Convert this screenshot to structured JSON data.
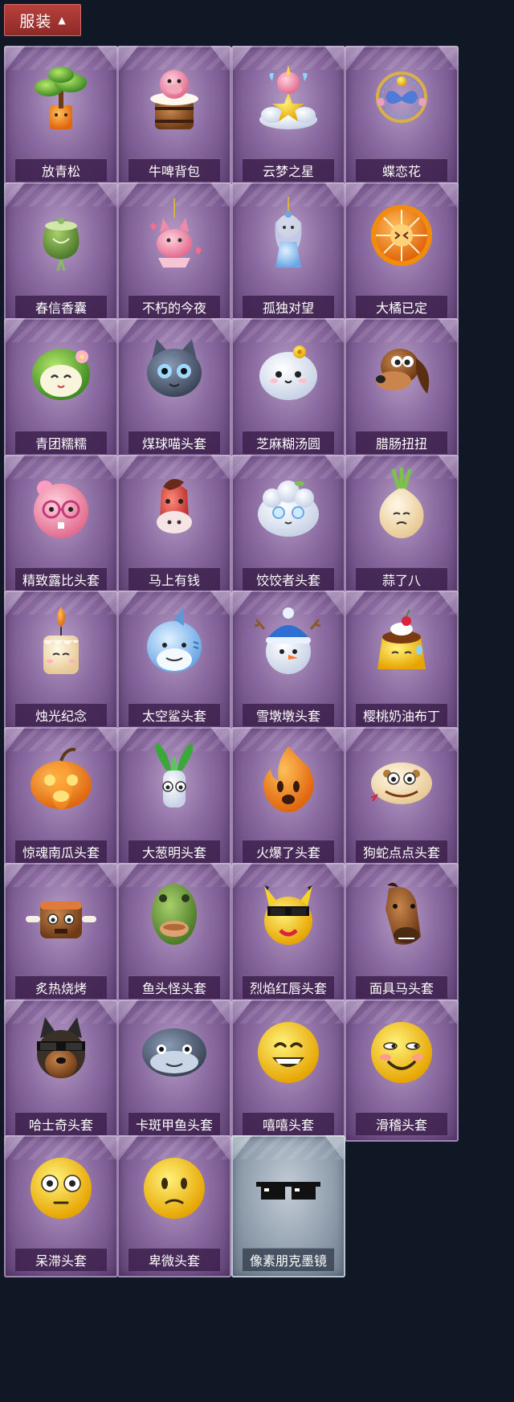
{
  "header": {
    "label": "服装",
    "icon": "chevron-up-icon"
  },
  "items": [
    {
      "name": "放青松",
      "icon": "bonsai-pine-icon",
      "rarity": "purple"
    },
    {
      "name": "牛啤背包",
      "icon": "cow-beer-backpack-icon",
      "rarity": "purple"
    },
    {
      "name": "云梦之星",
      "icon": "unicorn-cloud-star-icon",
      "rarity": "purple"
    },
    {
      "name": "蝶恋花",
      "icon": "butterfly-wreath-icon",
      "rarity": "purple"
    },
    {
      "name": "春信香囊",
      "icon": "sachet-icon",
      "rarity": "purple"
    },
    {
      "name": "不朽的今夜",
      "icon": "pink-fox-icon",
      "rarity": "purple"
    },
    {
      "name": "孤独对望",
      "icon": "doll-charm-icon",
      "rarity": "purple"
    },
    {
      "name": "大橘已定",
      "icon": "orange-slice-icon",
      "rarity": "purple"
    },
    {
      "name": "青团糯糯",
      "icon": "green-dumpling-icon",
      "rarity": "purple"
    },
    {
      "name": "煤球喵头套",
      "icon": "gray-cat-head-icon",
      "rarity": "purple"
    },
    {
      "name": "芝麻糊汤圆",
      "icon": "rice-ball-icon",
      "rarity": "purple"
    },
    {
      "name": "腊肠扭扭",
      "icon": "dachshund-head-icon",
      "rarity": "purple"
    },
    {
      "name": "精致露比头套",
      "icon": "pink-beaver-head-icon",
      "rarity": "purple"
    },
    {
      "name": "马上有钱",
      "icon": "red-horse-head-icon",
      "rarity": "purple"
    },
    {
      "name": "饺饺者头套",
      "icon": "dumpling-head-icon",
      "rarity": "purple"
    },
    {
      "name": "蒜了八",
      "icon": "garlic-icon",
      "rarity": "purple"
    },
    {
      "name": "烛光纪念",
      "icon": "candle-icon",
      "rarity": "purple"
    },
    {
      "name": "太空鲨头套",
      "icon": "shark-head-icon",
      "rarity": "purple"
    },
    {
      "name": "雪墩墩头套",
      "icon": "snowman-head-icon",
      "rarity": "purple"
    },
    {
      "name": "樱桃奶油布丁",
      "icon": "pudding-icon",
      "rarity": "purple"
    },
    {
      "name": "惊魂南瓜头套",
      "icon": "pumpkin-head-icon",
      "rarity": "purple"
    },
    {
      "name": "大葱明头套",
      "icon": "scallion-head-icon",
      "rarity": "purple"
    },
    {
      "name": "火爆了头套",
      "icon": "fire-head-icon",
      "rarity": "purple"
    },
    {
      "name": "狗蛇点点头套",
      "icon": "snake-head-icon",
      "rarity": "purple"
    },
    {
      "name": "炙热烧烤",
      "icon": "bbq-meat-icon",
      "rarity": "purple"
    },
    {
      "name": "鱼头怪头套",
      "icon": "fish-head-icon",
      "rarity": "purple"
    },
    {
      "name": "烈焰红唇头套",
      "icon": "yellow-mouse-head-icon",
      "rarity": "purple"
    },
    {
      "name": "面具马头套",
      "icon": "horse-mask-icon",
      "rarity": "purple"
    },
    {
      "name": "哈士奇头套",
      "icon": "husky-head-icon",
      "rarity": "purple"
    },
    {
      "name": "卡斑甲鱼头套",
      "icon": "turtle-head-icon",
      "rarity": "purple"
    },
    {
      "name": "嘻嘻头套",
      "icon": "grin-emoji-icon",
      "rarity": "purple"
    },
    {
      "name": "滑稽头套",
      "icon": "smirk-emoji-icon",
      "rarity": "purple"
    },
    {
      "name": "呆滞头套",
      "icon": "stare-emoji-icon",
      "rarity": "purple"
    },
    {
      "name": "卑微头套",
      "icon": "shy-emoji-icon",
      "rarity": "purple"
    },
    {
      "name": "像素朋克墨镜",
      "icon": "pixel-sunglasses-icon",
      "rarity": "gray"
    }
  ],
  "colors": {
    "background": "#0f1824",
    "header_button": "#a8362f",
    "card_purple": "#8a6aa0",
    "card_gray": "#9aa7b5"
  }
}
